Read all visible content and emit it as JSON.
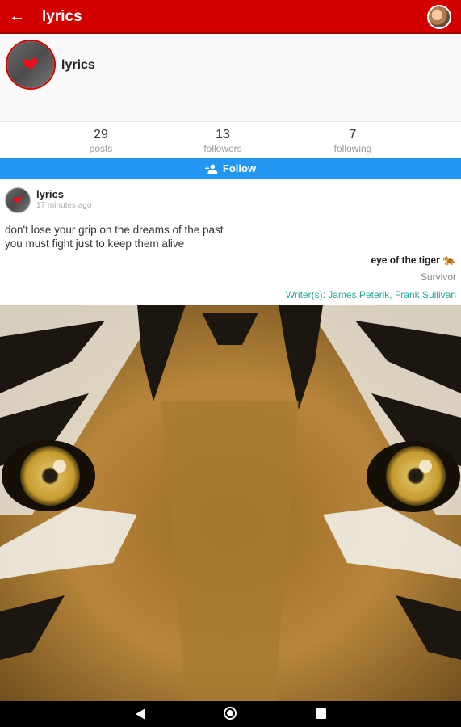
{
  "appbar": {
    "title": "lyrics",
    "back_icon": "arrow-left-icon"
  },
  "profile": {
    "name": "lyrics",
    "avatar_icon": "heart-icon"
  },
  "stats": {
    "posts": {
      "value": "29",
      "label": "posts"
    },
    "followers": {
      "value": "13",
      "label": "followers"
    },
    "following": {
      "value": "7",
      "label": "following"
    }
  },
  "follow_button": {
    "label": "Follow",
    "icon": "person-add-icon"
  },
  "post": {
    "author": "lyrics",
    "time": "17 minutes ago",
    "lyrics_line1": "don't lose your grip on the dreams of the past",
    "lyrics_line2": "you must fight just to keep them alive",
    "song": "eye of the tiger",
    "song_icon": "tiger-emoji",
    "artist": "Survivor",
    "writers": "Writer(s): James Peterik, Frank Sullivan",
    "image": "tiger-eyes-closeup"
  },
  "colors": {
    "appbar": "#d40000",
    "follow": "#2196f3",
    "writers": "#26a69a"
  }
}
